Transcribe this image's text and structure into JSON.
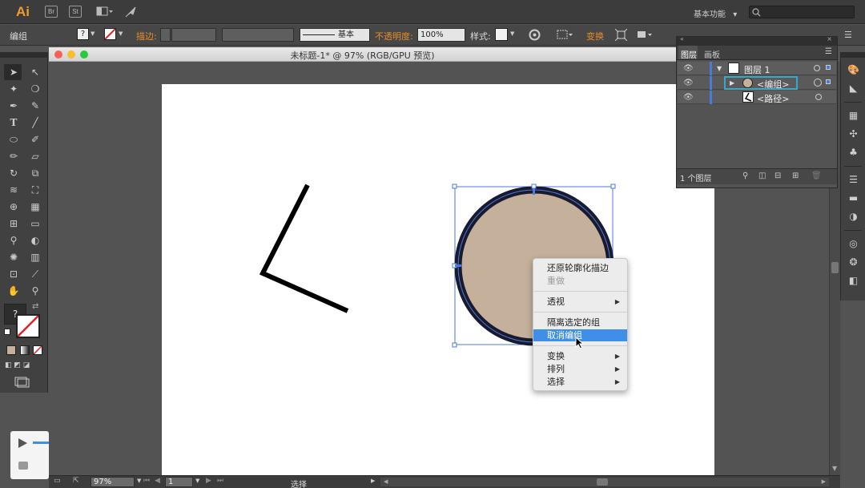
{
  "app": {
    "logo": "Ai",
    "bridge_label": "Br",
    "stock_label": "St",
    "workspace_label": "基本功能",
    "workspace_caret": "▾"
  },
  "control_bar": {
    "selection_type": "编组",
    "stroke_label": "描边:",
    "stroke_profile": "基本",
    "opacity_label": "不透明度:",
    "opacity_value": "100%",
    "style_label": "样式:",
    "transform_label": "变换",
    "unknown_fill_glyph": "?"
  },
  "document": {
    "title": "未标题-1* @ 97% (RGB/GPU 预览)"
  },
  "context_menu": {
    "items": [
      {
        "label": "还原轮廓化描边",
        "disabled": false,
        "submenu": false
      },
      {
        "label": "重做",
        "disabled": true,
        "submenu": false
      },
      {
        "label": "透视",
        "disabled": false,
        "submenu": true
      },
      {
        "label": "隔离选定的组",
        "disabled": false,
        "submenu": false
      },
      {
        "label": "取消编组",
        "disabled": false,
        "submenu": false,
        "selected": true
      },
      {
        "label": "变换",
        "disabled": false,
        "submenu": true
      },
      {
        "label": "排列",
        "disabled": false,
        "submenu": true
      },
      {
        "label": "选择",
        "disabled": false,
        "submenu": true
      }
    ],
    "submenu_arrow": "▶"
  },
  "layers_panel": {
    "tabs": [
      "图层",
      "画板"
    ],
    "rows": [
      {
        "name": "图层 1"
      },
      {
        "name": "<编组>"
      },
      {
        "name": "<路径>"
      }
    ],
    "footer_count": "1 个图层"
  },
  "status_bar": {
    "zoom": "97%",
    "page": "1",
    "tool_status": "选择"
  },
  "colors": {
    "circle_fill": "#c4b09b",
    "circle_stroke": "#1a1a2e",
    "selection": "#4a7bd8",
    "menu_highlight": "#3f8ee8",
    "layer_highlight": "#36a9c9",
    "app_accent": "#f39a2e"
  },
  "icons": {
    "search": "search-icon",
    "hand": "hand-icon",
    "zoom": "zoom-icon",
    "type": "type-icon",
    "visibility": "eye-icon"
  }
}
